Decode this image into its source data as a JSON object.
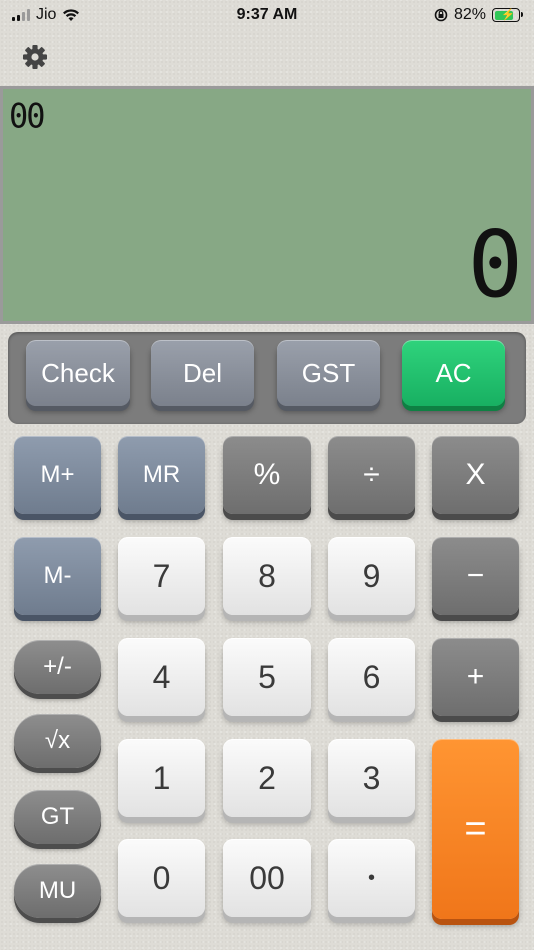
{
  "status_bar": {
    "carrier": "Jio",
    "time": "9:37 AM",
    "battery_percent": "82%",
    "battery_level": 0.82,
    "icons": [
      "signal-icon",
      "wifi-icon",
      "rotation-lock-icon",
      "battery-charging-icon"
    ]
  },
  "settings": {
    "icon": "gear-icon"
  },
  "display": {
    "secondary_text": "00",
    "main_value": "0",
    "background_color": "#87a885"
  },
  "function_keys": {
    "check": "Check",
    "del": "Del",
    "gst": "GST",
    "ac": "AC"
  },
  "keypad": {
    "m_plus": "M+",
    "mr": "MR",
    "percent": "%",
    "divide": "÷",
    "multiply": "X",
    "m_minus": "M-",
    "minus": "−",
    "plus": "+",
    "plus_minus": "+/-",
    "sqrt": "√x",
    "gt": "GT",
    "mu": "MU",
    "equals": "=",
    "digit_7": "7",
    "digit_8": "8",
    "digit_9": "9",
    "digit_4": "4",
    "digit_5": "5",
    "digit_6": "6",
    "digit_1": "1",
    "digit_2": "2",
    "digit_3": "3",
    "digit_0": "0",
    "double_zero": "00",
    "decimal": "•"
  },
  "colors": {
    "accent_green": "#1fbf6c",
    "equals_orange": "#f7821f"
  }
}
